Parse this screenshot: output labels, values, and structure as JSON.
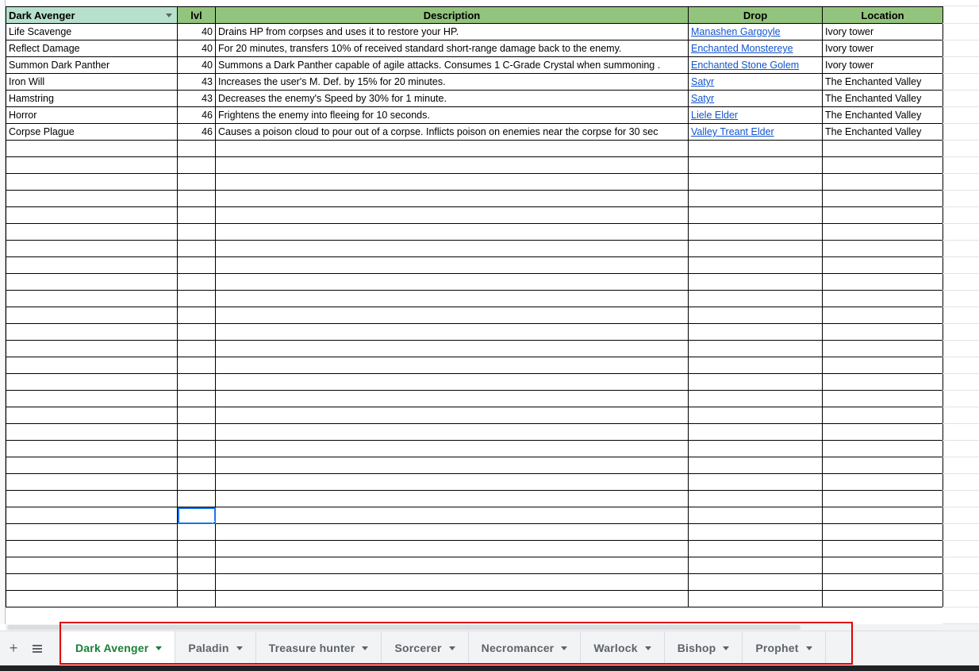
{
  "sheet": {
    "headers": {
      "col_a": "Dark Avenger",
      "col_b": "lvl",
      "col_c": "Description",
      "col_d": "Drop",
      "col_e": "Location"
    },
    "rows": [
      {
        "name": "Life Scavenge",
        "lvl": "40",
        "description": "Drains HP from corpses and uses it to restore your HP.",
        "drop": "Manashen Gargoyle",
        "location": "Ivory tower"
      },
      {
        "name": "Reflect Damage",
        "lvl": "40",
        "description": "For 20 minutes, transfers 10% of received standard short-range damage back to the enemy.",
        "drop": "Enchanted Monstereye",
        "location": "Ivory tower"
      },
      {
        "name": "Summon Dark Panther",
        "lvl": "40",
        "description": "Summons a Dark Panther capable of agile attacks. Consumes 1 C-Grade Crystal when summoning .",
        "drop": "Enchanted Stone Golem",
        "location": "Ivory tower"
      },
      {
        "name": "Iron Will",
        "lvl": "43",
        "description": "Increases the user's M. Def. by 15% for 20 minutes.",
        "drop": "Satyr",
        "location": "The Enchanted Valley"
      },
      {
        "name": "Hamstring",
        "lvl": "43",
        "description": "Decreases the enemy's Speed by 30% for 1 minute.",
        "drop": "Satyr",
        "location": "The Enchanted Valley"
      },
      {
        "name": "Horror",
        "lvl": "46",
        "description": "Frightens the enemy into fleeing for 10 seconds.",
        "drop": "Liele Elder",
        "location": "The Enchanted Valley"
      },
      {
        "name": "Corpse Plague",
        "lvl": "46",
        "description": "Causes a poison cloud to pour out of a corpse. Inflicts poison on enemies near the corpse for 30 sec",
        "drop": "Valley Treant Elder",
        "location": "The Enchanted Valley"
      }
    ]
  },
  "tabbar": {
    "add_label": "+",
    "tabs": [
      {
        "label": "Dark Avenger",
        "active": true
      },
      {
        "label": "Paladin",
        "active": false
      },
      {
        "label": "Treasure hunter",
        "active": false
      },
      {
        "label": "Sorcerer",
        "active": false
      },
      {
        "label": "Necromancer",
        "active": false
      },
      {
        "label": "Warlock",
        "active": false
      },
      {
        "label": "Bishop",
        "active": false
      },
      {
        "label": "Prophet",
        "active": false
      }
    ]
  },
  "colors": {
    "header_green": "#93c47d",
    "first_header_green": "#b7e1cd",
    "link_blue": "#1155cc",
    "active_tab_green": "#188038",
    "highlight_red": "#e00000"
  }
}
